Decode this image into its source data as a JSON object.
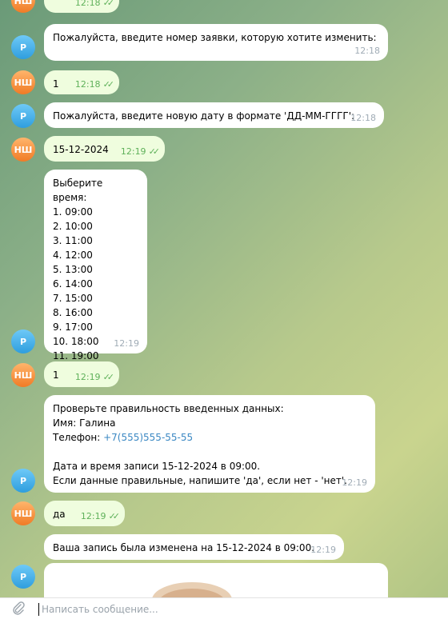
{
  "composer": {
    "placeholder": "Написать сообщение..."
  },
  "avatars": {
    "bot": "Р",
    "user": "НШ"
  },
  "messages": [
    {
      "id": "m0",
      "direction": "out",
      "text": "",
      "time": "12:18",
      "read": true
    },
    {
      "id": "m1",
      "direction": "in",
      "text": "Пожалуйста, введите номер заявки, которую хотите изменить:",
      "time": "12:18"
    },
    {
      "id": "m2",
      "direction": "out",
      "text": "1",
      "time": "12:18",
      "read": true
    },
    {
      "id": "m3",
      "direction": "in",
      "text": "Пожалуйста, введите новую дату в формате 'ДД-ММ-ГГГГ':",
      "time": "12:18"
    },
    {
      "id": "m4",
      "direction": "out",
      "text": "15-12-2024",
      "time": "12:19",
      "read": true
    },
    {
      "id": "m5",
      "direction": "in",
      "text": "Выберите время:\n1. 09:00\n2. 10:00\n3. 11:00\n4. 12:00\n5. 13:00\n6. 14:00\n7. 15:00\n8. 16:00\n9. 17:00\n10. 18:00\n11. 19:00",
      "time": "12:19"
    },
    {
      "id": "m6",
      "direction": "out",
      "text": "1",
      "time": "12:19",
      "read": true
    },
    {
      "id": "m7",
      "direction": "in",
      "line1": "Проверьте правильность введенных данных:",
      "line2": "Имя: Галина",
      "phone_label": "Телефон: ",
      "phone": "+7(555)555-55-55",
      "line4": "Дата и время записи 15-12-2024 в 09:00.",
      "line5": "Если данные правильные, напишите 'да', если нет - 'нет'.",
      "time": "12:19"
    },
    {
      "id": "m8",
      "direction": "out",
      "text": "да",
      "time": "12:19",
      "read": true
    },
    {
      "id": "m9",
      "direction": "in",
      "text": "Ваша запись была изменена на 15-12-2024 в 09:00.",
      "time": "12:19"
    }
  ],
  "colors": {
    "incoming": "#ffffff",
    "outgoing": "#effdde",
    "link": "#3b88c3",
    "check": "#5fb15a"
  }
}
